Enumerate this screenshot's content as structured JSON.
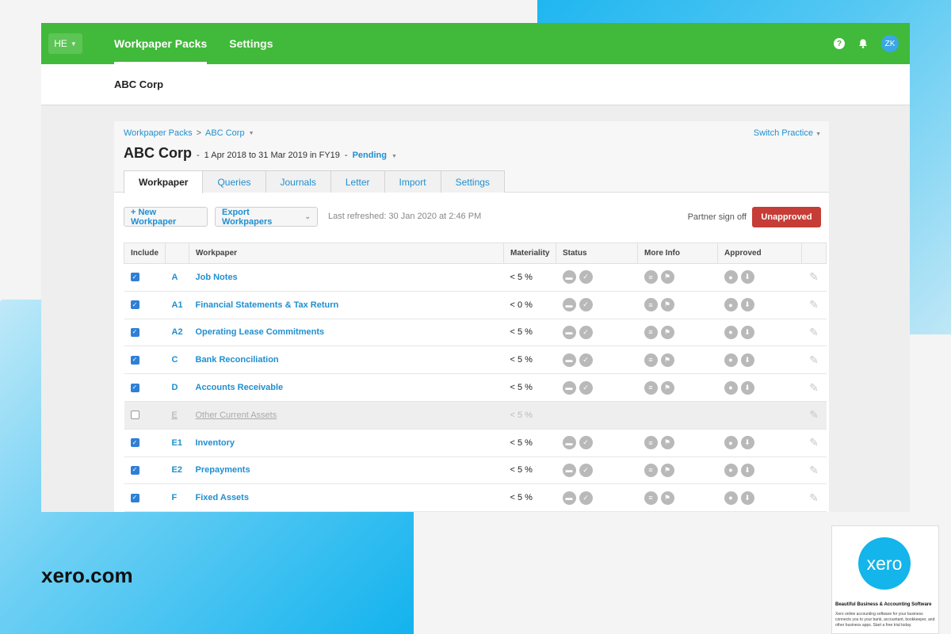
{
  "app": {
    "org_switcher": "HE",
    "nav": [
      {
        "label": "Workpaper Packs"
      },
      {
        "label": "Settings"
      }
    ],
    "user_initials": "ZK",
    "help_symbol": "?",
    "org_name": "ABC Corp"
  },
  "panel": {
    "breadcrumb": {
      "root": "Workpaper Packs",
      "sep": ">",
      "current": "ABC Corp"
    },
    "switch_practice": "Switch Practice",
    "title": "ABC Corp",
    "title_dash": "-",
    "period": "1 Apr 2018 to 31 Mar 2019 in FY19",
    "status_dash": "-",
    "status": "Pending",
    "tabs": [
      "Workpaper",
      "Queries",
      "Journals",
      "Letter",
      "Import",
      "Settings"
    ],
    "toolbar": {
      "new_workpaper": "+ New Workpaper",
      "export_workpapers": "Export Workpapers",
      "last_refreshed": "Last refreshed: 30 Jan 2020 at 2:46 PM",
      "partner_sign_off": "Partner sign off",
      "approval_button": "Unapproved"
    },
    "columns": [
      "Include",
      "",
      "Workpaper",
      "Materiality",
      "Status",
      "More Info",
      "Approved",
      ""
    ],
    "rows": [
      {
        "included": true,
        "code": "A",
        "name": "Job Notes",
        "materiality": "< 5 %"
      },
      {
        "included": true,
        "code": "A1",
        "name": "Financial Statements & Tax Return",
        "materiality": "< 0 %"
      },
      {
        "included": true,
        "code": "A2",
        "name": "Operating Lease Commitments",
        "materiality": "< 5 %"
      },
      {
        "included": true,
        "code": "C",
        "name": "Bank Reconciliation",
        "materiality": "< 5 %"
      },
      {
        "included": true,
        "code": "D",
        "name": "Accounts Receivable",
        "materiality": "< 5 %"
      },
      {
        "included": false,
        "code": "E",
        "name": "Other Current Assets",
        "materiality": "< 5 %"
      },
      {
        "included": true,
        "code": "E1",
        "name": "Inventory",
        "materiality": "< 5 %"
      },
      {
        "included": true,
        "code": "E2",
        "name": "Prepayments",
        "materiality": "< 5 %"
      },
      {
        "included": true,
        "code": "F",
        "name": "Fixed Assets",
        "materiality": "< 5 %"
      }
    ]
  },
  "footer": {
    "site": "xero.com",
    "card": {
      "logo_text": "xero",
      "title": "Beautiful Business & Accounting Software",
      "description": "Xero online accounting software for your business connects you to your bank, accountant, bookkeeper, and other business apps. Start a free trial today."
    }
  },
  "colors": {
    "topbar": "#41b93a",
    "link": "#1f8fd0",
    "unapproved": "#c53d36",
    "xero_blue": "#13b5ea"
  }
}
